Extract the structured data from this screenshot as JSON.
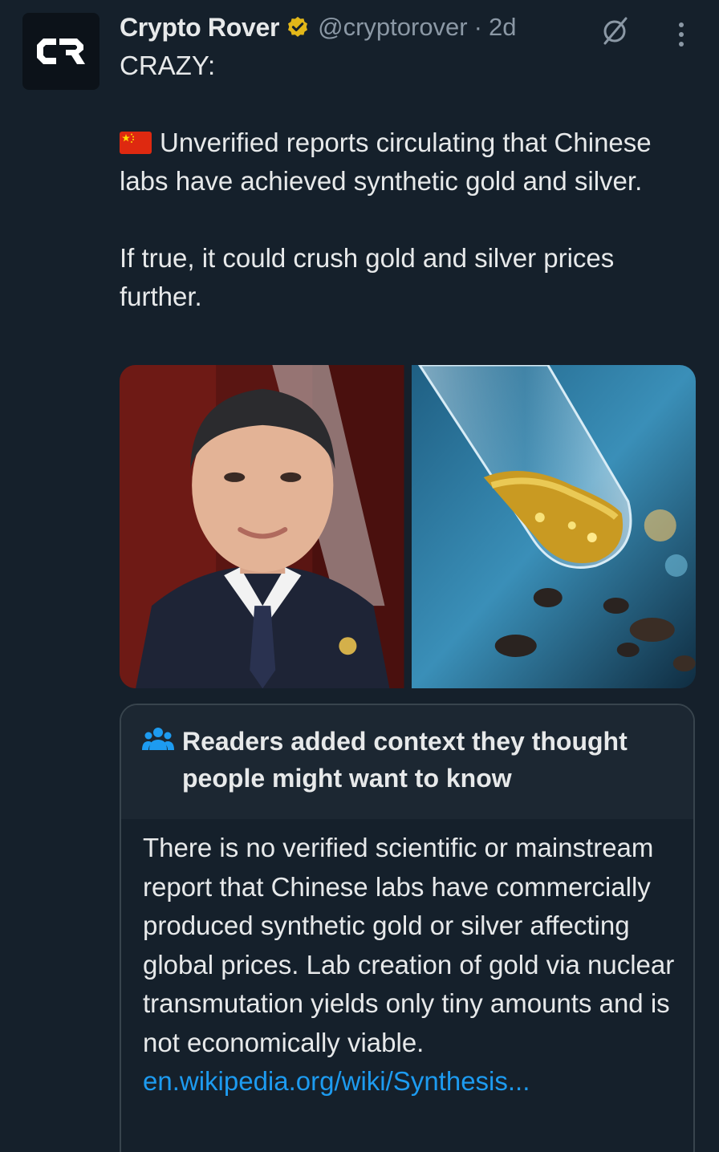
{
  "tweet": {
    "author_name": "Crypto Rover",
    "handle": "@cryptorover",
    "separator": "·",
    "time": "2d",
    "avatar_text": "CR",
    "text_line1": "CRAZY:",
    "text_para2": "Unverified reports circulating that Chinese labs have achieved synthetic gold and silver.",
    "text_para3": "If true, it could crush gold and silver prices further."
  },
  "community_note": {
    "title": "Readers added context they thought people might want to know",
    "body": "There is no verified scientific or mainstream report that Chinese labs have commercially produced synthetic gold or silver affecting global prices. Lab creation of gold via nuclear transmutation yields only tiny amounts and is not economically viable.",
    "link": "en.wikipedia.org/wiki/Synthesis..."
  },
  "colors": {
    "background": "#15202b",
    "text": "#e7e9ea",
    "secondary": "#8b98a5",
    "link": "#1d9bf0",
    "verified_badge": "#e2b719",
    "note_header": "#1c2732"
  },
  "icons": {
    "verified": "verified-badge-icon",
    "grok": "grok-icon",
    "more": "more-vertical-icon",
    "flag": "china-flag-icon",
    "note": "people-group-icon"
  }
}
